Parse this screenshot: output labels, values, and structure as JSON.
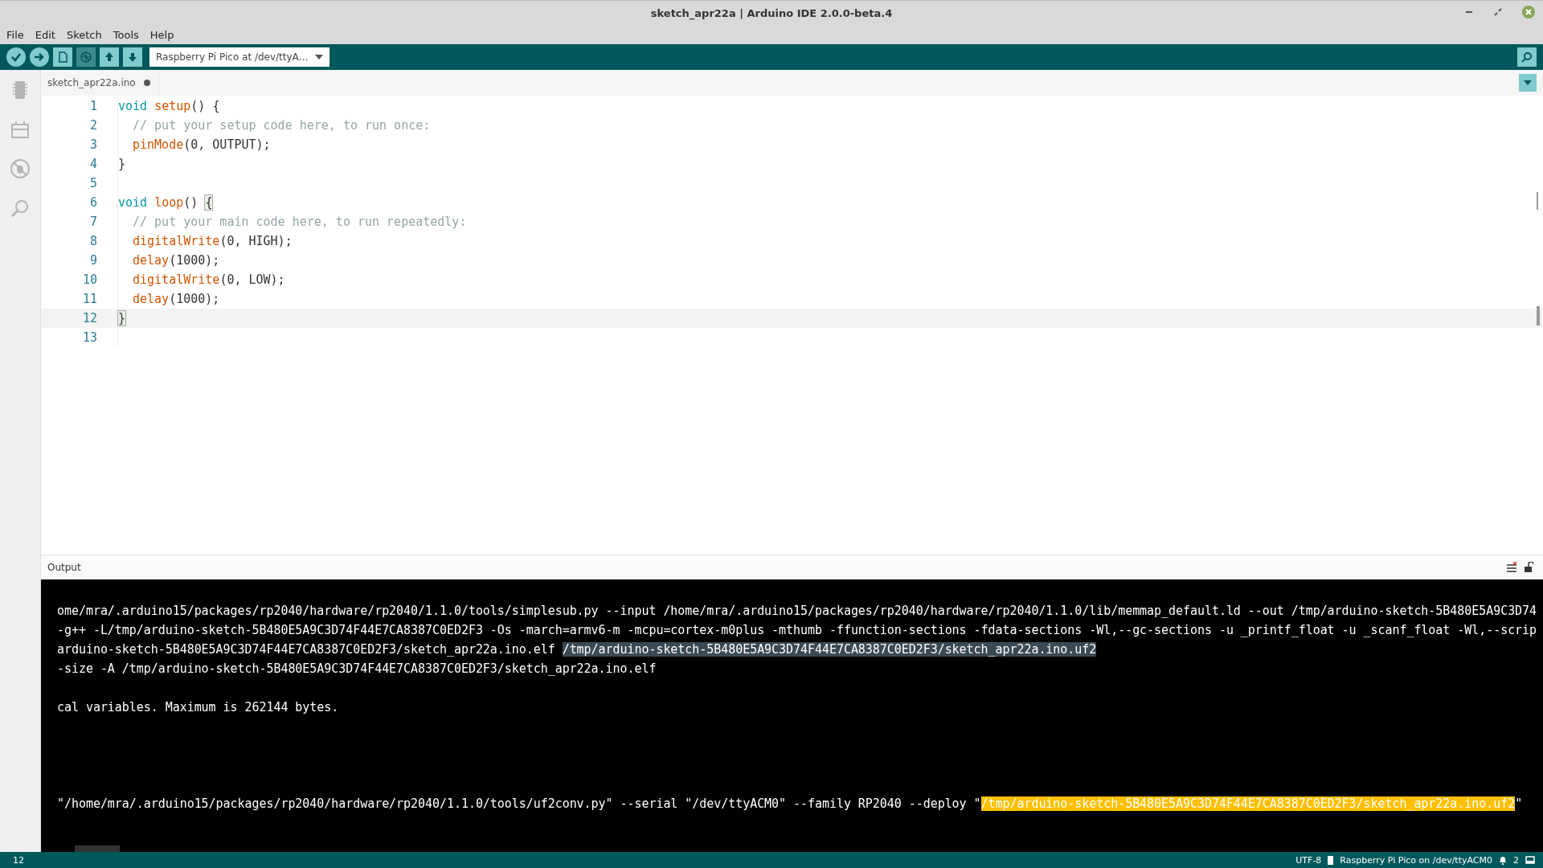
{
  "window": {
    "title": "sketch_apr22a | Arduino IDE 2.0.0-beta.4"
  },
  "menu": [
    "File",
    "Edit",
    "Sketch",
    "Tools",
    "Help"
  ],
  "toolbar": {
    "buttons": [
      {
        "kind": "verify",
        "disabled": false
      },
      {
        "kind": "upload",
        "disabled": false
      },
      {
        "kind": "new",
        "disabled": false
      },
      {
        "kind": "debug",
        "disabled": true
      },
      {
        "kind": "open",
        "disabled": false
      },
      {
        "kind": "save",
        "disabled": false
      }
    ],
    "board": "Raspberry Pi Pico at /dev/ttyA…"
  },
  "tab": {
    "label": "sketch_apr22a.ino",
    "modified": true
  },
  "editor": {
    "lines": [
      {
        "number": "1",
        "current": false,
        "indented": false,
        "tokens": [
          {
            "kind": "keyword",
            "text": "void "
          },
          {
            "kind": "function",
            "text": "setup"
          },
          {
            "kind": "plain",
            "text": "() {"
          }
        ]
      },
      {
        "number": "2",
        "current": false,
        "indented": true,
        "tokens": [
          {
            "kind": "comment",
            "text": "// put your setup code here, to run once:"
          }
        ]
      },
      {
        "number": "3",
        "current": false,
        "indented": true,
        "tokens": [
          {
            "kind": "function",
            "text": "pinMode"
          },
          {
            "kind": "plain",
            "text": "(0, OUTPUT);"
          }
        ]
      },
      {
        "number": "4",
        "current": false,
        "indented": false,
        "tokens": [
          {
            "kind": "plain",
            "text": "}"
          }
        ]
      },
      {
        "number": "5",
        "current": false
      },
      {
        "number": "6",
        "current": false,
        "indented": false,
        "tokens": [
          {
            "kind": "keyword",
            "text": "void "
          },
          {
            "kind": "function",
            "text": "loop"
          },
          {
            "kind": "plain",
            "text": "() "
          },
          {
            "kind": "bracket",
            "text": "{"
          }
        ]
      },
      {
        "number": "7",
        "current": false,
        "indented": true,
        "tokens": [
          {
            "kind": "comment",
            "text": "// put your main code here, to run repeatedly:"
          }
        ]
      },
      {
        "number": "8",
        "current": false,
        "indented": true,
        "tokens": [
          {
            "kind": "function",
            "text": "digitalWrite"
          },
          {
            "kind": "plain",
            "text": "(0, HIGH);"
          }
        ]
      },
      {
        "number": "9",
        "current": false,
        "indented": true,
        "tokens": [
          {
            "kind": "function",
            "text": "delay"
          },
          {
            "kind": "plain",
            "text": "(1000);"
          }
        ]
      },
      {
        "number": "10",
        "current": false,
        "indented": true,
        "tokens": [
          {
            "kind": "function",
            "text": "digitalWrite"
          },
          {
            "kind": "plain",
            "text": "(0, LOW);"
          }
        ]
      },
      {
        "number": "11",
        "current": false,
        "indented": true,
        "tokens": [
          {
            "kind": "function",
            "text": "delay"
          },
          {
            "kind": "plain",
            "text": "(1000);"
          }
        ]
      },
      {
        "number": "12",
        "current": true,
        "indented": false,
        "tokens": [
          {
            "kind": "bracket",
            "text": "}"
          }
        ]
      },
      {
        "number": "13",
        "current": false
      }
    ]
  },
  "output": {
    "title": "Output",
    "lines": [
      {
        "kind": "text",
        "segments": [
          {
            "kind": "plain",
            "text": "ome/mra/.arduino15/packages/rp2040/hardware/rp2040/1.1.0/tools/simplesub.py --input /home/mra/.arduino15/packages/rp2040/hardware/rp2040/1.1.0/lib/memmap_default.ld --out /tmp/arduino-sketch-5B480E5A9C3D74"
          }
        ]
      },
      {
        "kind": "text",
        "segments": [
          {
            "kind": "plain",
            "text": "-g++ -L/tmp/arduino-sketch-5B480E5A9C3D74F44E7CA8387C0ED2F3 -Os -march=armv6-m -mcpu=cortex-m0plus -mthumb -ffunction-sections -fdata-sections -Wl,--gc-sections -u _printf_float -u _scanf_float -Wl,--scrip"
          }
        ]
      },
      {
        "kind": "text",
        "segments": [
          {
            "kind": "plain",
            "text": "arduino-sketch-5B480E5A9C3D74F44E7CA8387C0ED2F3/sketch_apr22a.ino.elf "
          },
          {
            "kind": "selected",
            "text": "/tmp/arduino-sketch-5B480E5A9C3D74F44E7CA8387C0ED2F3/sketch_apr22a.ino.uf2"
          }
        ]
      },
      {
        "kind": "text",
        "segments": [
          {
            "kind": "plain",
            "text": "-size -A /tmp/arduino-sketch-5B480E5A9C3D74F44E7CA8387C0ED2F3/sketch_apr22a.ino.elf"
          }
        ]
      },
      {
        "kind": "blank"
      },
      {
        "kind": "text",
        "segments": [
          {
            "kind": "plain",
            "text": "cal variables. Maximum is 262144 bytes."
          }
        ]
      },
      {
        "kind": "blank"
      },
      {
        "kind": "blank"
      },
      {
        "kind": "blank"
      },
      {
        "kind": "blank"
      },
      {
        "kind": "text",
        "segments": [
          {
            "kind": "plain",
            "text": "\"/home/mra/.arduino15/packages/rp2040/hardware/rp2040/1.1.0/tools/uf2conv.py\" --serial \"/dev/ttyACM0\" --family RP2040 --deploy \""
          },
          {
            "kind": "highlight",
            "text": "/tmp/arduino-sketch-5B480E5A9C3D74F44E7CA8387C0ED2F3/sketch_apr22a.ino.uf2"
          },
          {
            "kind": "plain",
            "text": "\""
          }
        ]
      }
    ]
  },
  "status_bar": {
    "line": "12",
    "encoding": "UTF-8",
    "board": "Raspberry Pi Pico on /dev/ttyACM0",
    "notifications": "2"
  }
}
